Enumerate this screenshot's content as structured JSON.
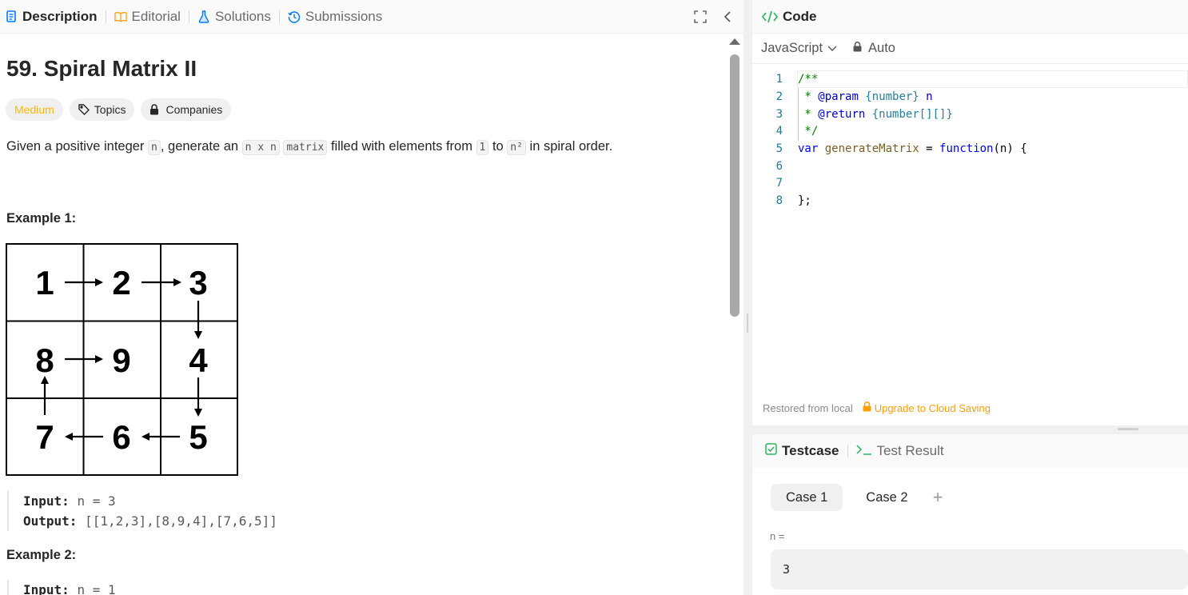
{
  "left_tabs": [
    {
      "label": "Description",
      "icon": "description-icon",
      "active": true
    },
    {
      "label": "Editorial",
      "icon": "book-icon"
    },
    {
      "label": "Solutions",
      "icon": "flask-icon"
    },
    {
      "label": "Submissions",
      "icon": "history-icon"
    }
  ],
  "problem": {
    "title": "59. Spiral Matrix II",
    "difficulty": "Medium",
    "topics_label": "Topics",
    "companies_label": "Companies",
    "desc_parts": {
      "p1": "Given a positive integer ",
      "code_n": "n",
      "p2": ", generate an ",
      "code_nxn": "n x n",
      "p3": " ",
      "code_matrix": "matrix",
      "p4": " filled with elements from ",
      "code_1": "1",
      "p5": " to ",
      "code_n2": "n²",
      "p6": " in spiral order."
    },
    "example1": {
      "heading": "Example 1:",
      "grid": [
        [
          "1",
          "2",
          "3"
        ],
        [
          "8",
          "9",
          "4"
        ],
        [
          "7",
          "6",
          "5"
        ]
      ],
      "input_label": "Input:",
      "input_value": "n = 3",
      "output_label": "Output:",
      "output_value": "[[1,2,3],[8,9,4],[7,6,5]]"
    },
    "example2": {
      "heading": "Example 2:",
      "input_label": "Input:",
      "input_value": "n = 1"
    }
  },
  "code_panel": {
    "title": "Code",
    "language": "JavaScript",
    "mode": "Auto",
    "lines": [
      {
        "n": "1"
      },
      {
        "n": "2"
      },
      {
        "n": "3"
      },
      {
        "n": "4"
      },
      {
        "n": "5"
      },
      {
        "n": "6"
      },
      {
        "n": "7"
      },
      {
        "n": "8"
      }
    ],
    "status": "Restored from local",
    "upgrade": "Upgrade to Cloud Saving"
  },
  "test_panel": {
    "testcase_label": "Testcase",
    "result_label": "Test Result",
    "cases": [
      "Case 1",
      "Case 2"
    ],
    "add_label": "+",
    "param_label": "n =",
    "param_value": "3"
  },
  "colors": {
    "medium": "#ffb800",
    "link_blue": "#007aff",
    "green": "#2db55d",
    "orange": "#ff9f0a"
  }
}
